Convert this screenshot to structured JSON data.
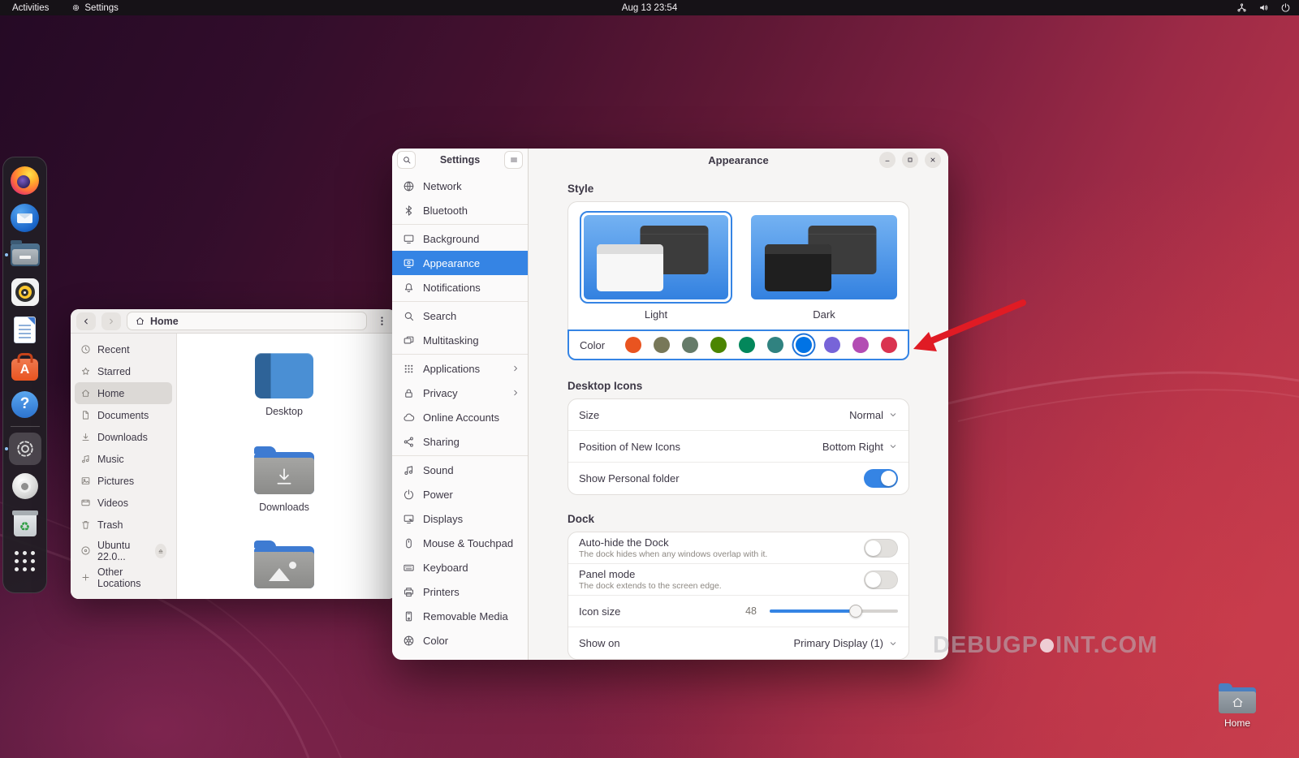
{
  "topbar": {
    "activities_label": "Activities",
    "focused_app": "Settings",
    "clock": "Aug 13 23:54",
    "tray_icons": [
      "network-icon",
      "volume-icon",
      "power-icon"
    ]
  },
  "dock": {
    "items": [
      {
        "id": "firefox",
        "label": "Firefox"
      },
      {
        "id": "thunderbird",
        "label": "Thunderbird"
      },
      {
        "id": "files",
        "label": "Files",
        "running": true
      },
      {
        "id": "rhythmbox",
        "label": "Rhythmbox"
      },
      {
        "id": "writer",
        "label": "LibreOffice Writer"
      },
      {
        "id": "software",
        "label": "Ubuntu Software"
      },
      {
        "id": "help",
        "label": "Help",
        "sep_after": true
      },
      {
        "id": "settings",
        "label": "Settings",
        "running": true,
        "active": true
      },
      {
        "id": "disc",
        "label": "Disc"
      },
      {
        "id": "trash",
        "label": "Trash"
      },
      {
        "id": "appgrid",
        "label": "Show Applications"
      }
    ]
  },
  "files_window": {
    "nav": {
      "location_label": "Home"
    },
    "sidebar": [
      {
        "label": "Recent",
        "icon": "clock"
      },
      {
        "label": "Starred",
        "icon": "star"
      },
      {
        "label": "Home",
        "icon": "home",
        "selected": true
      },
      {
        "label": "Documents",
        "icon": "doc"
      },
      {
        "label": "Downloads",
        "icon": "download"
      },
      {
        "label": "Music",
        "icon": "note"
      },
      {
        "label": "Pictures",
        "icon": "image"
      },
      {
        "label": "Videos",
        "icon": "video"
      },
      {
        "label": "Trash",
        "icon": "trash"
      },
      {
        "label": "Ubuntu 22.0...",
        "icon": "disc",
        "eject": true,
        "cls": "mount"
      },
      {
        "label": "Other Locations",
        "icon": "plus",
        "cls": "other"
      }
    ],
    "items": [
      {
        "label": "Desktop"
      },
      {
        "label": "Downloads"
      },
      {
        "label": ""
      }
    ]
  },
  "settings_window": {
    "window_title": "Settings",
    "page_title": "Appearance",
    "sidebar": [
      {
        "label": "Network",
        "icon": "globe"
      },
      {
        "label": "Bluetooth",
        "icon": "bluetooth",
        "sep_after": true
      },
      {
        "label": "Background",
        "icon": "display"
      },
      {
        "label": "Appearance",
        "icon": "appearance",
        "selected": true
      },
      {
        "label": "Notifications",
        "icon": "bell",
        "sep_after": true
      },
      {
        "label": "Search",
        "icon": "search"
      },
      {
        "label": "Multitasking",
        "icon": "multitask",
        "sep_after": true
      },
      {
        "label": "Applications",
        "icon": "grid",
        "chevron": true
      },
      {
        "label": "Privacy",
        "icon": "lock",
        "chevron": true
      },
      {
        "label": "Online Accounts",
        "icon": "cloud"
      },
      {
        "label": "Sharing",
        "icon": "share",
        "sep_after": true
      },
      {
        "label": "Sound",
        "icon": "note"
      },
      {
        "label": "Power",
        "icon": "power"
      },
      {
        "label": "Displays",
        "icon": "displays"
      },
      {
        "label": "Mouse & Touchpad",
        "icon": "mouse"
      },
      {
        "label": "Keyboard",
        "icon": "keyboard"
      },
      {
        "label": "Printers",
        "icon": "printer"
      },
      {
        "label": "Removable Media",
        "icon": "removable"
      },
      {
        "label": "Color",
        "icon": "colorwheel"
      }
    ],
    "style": {
      "header": "Style",
      "light_label": "Light",
      "dark_label": "Dark",
      "selected_style": "Light",
      "color_label": "Color",
      "swatches": [
        "#E95420",
        "#787859",
        "#657B69",
        "#4B8501",
        "#03875B",
        "#308280",
        "#0073E5",
        "#7764D8",
        "#B34CB3",
        "#DA3450"
      ],
      "selected_swatch_index": 6
    },
    "desktop_icons": {
      "header": "Desktop Icons",
      "size_label": "Size",
      "size_value": "Normal",
      "position_label": "Position of New Icons",
      "position_value": "Bottom Right",
      "personal_folder_label": "Show Personal folder",
      "personal_folder_on": true
    },
    "dock_prefs": {
      "header": "Dock",
      "autohide_label": "Auto-hide the Dock",
      "autohide_desc": "The dock hides when any windows overlap with it.",
      "autohide_on": false,
      "panel_label": "Panel mode",
      "panel_desc": "The dock extends to the screen edge.",
      "panel_on": false,
      "icon_size_label": "Icon size",
      "icon_size_value": "48",
      "show_on_label": "Show on",
      "show_on_value": "Primary Display (1)"
    }
  },
  "desktop": {
    "home_shortcut_label": "Home"
  },
  "watermark": {
    "before": "DEBUGP",
    "after": "INT.COM"
  },
  "colors": {
    "accent": "#3584e4",
    "arrow_red": "#e01b24",
    "topbar_bg": "#161217"
  }
}
